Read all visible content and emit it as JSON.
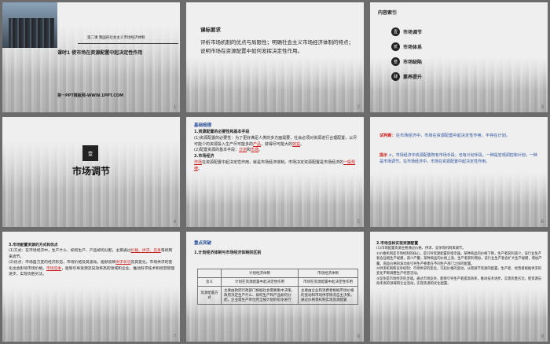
{
  "slides": [
    {
      "number": "1",
      "lesson_subtitle": "第二课  我国的社会主义市场经济体制",
      "lesson_title": "课时1    使市场在资源配置中起决定性作用",
      "watermark": "第一PPT模板网-WWW.1PPT.COM"
    },
    {
      "number": "2",
      "heading": "课标要求",
      "body": "评析市场机制的优点与局限性；明确社会主义市场经济体制的特点；说明市场在资源配置中如何发挥决定性作用。"
    },
    {
      "number": "3",
      "heading": "内容索引",
      "items": [
        {
          "badge": "壹",
          "label": "市场调节"
        },
        {
          "badge": "贰",
          "label": "市场体系"
        },
        {
          "badge": "叁",
          "label": "市场缺陷"
        },
        {
          "badge": "肆",
          "label": "素养提升"
        }
      ]
    },
    {
      "number": "4",
      "badge": "壹",
      "title": "市场调节"
    },
    {
      "number": "5",
      "tag": "基础梳理",
      "h1": "1.资源配置的必要性和基本手段",
      "p1a": "(1)资源配置的必要性：为了更好满足人类的多方面需要，社会必须对资源进行合理配置，以尽可能少的资源投入生产尽可能多的",
      "p1_blank1": "产品",
      "p1b": "，获得尽可能大的",
      "p1_blank2": "效益",
      "p1c": "。",
      "p2a": "(2)配置资源的基本手段：",
      "p2_blank1": "计划",
      "p2b": "和",
      "p2_blank2": "市场",
      "p2c": "。",
      "h2": "2.市场经济",
      "p3_blank1": "市场",
      "p3a": "在资源配置中起决定性作用，就是市场经济体制。市场决定资源配置是市场经济的",
      "p3_blank2": "一般规律",
      "p3b": "。"
    },
    {
      "number": "6",
      "l1_tag": "试判断：",
      "l1": "在市场经济中，市场在资源配置中起决定性作用，不存在计划。",
      "l2_tag": "提示",
      "l2": "×。市场经济中资源配置既有市场手段，也有计划手段。一种是宏观调控和计划；一种是市场调节。在市场经济中，市场在资源配置中起决定性作用。"
    },
    {
      "number": "7",
      "h1": "3.市场配置资源的方式和优点",
      "p1a": "(1)方式：在市场经济中，生产什么、如何生产、产品如何分配，主要通过",
      "p1_blank1": "价格、供求、竞争",
      "p1b": "等机制来调节。",
      "p2a": "(2)优点：市场是万变的经济形态，市场价格及其波动，能够反映",
      "p2_blank1": "供求状况",
      "p2b": "及其变化，市场供求的变化也会影响市场价格。",
      "p2_blank2": "市场竞争",
      "p2c": "，能够引导资源流向效率高的领域和企业，推动科学技术和经营管理进步，实现优胜劣汰。"
    },
    {
      "number": "8",
      "tag": "重点突破",
      "heading": "1.计划经济体制与市场经济体制的区别",
      "table": {
        "headers": [
          "",
          "计划经济体制",
          "市场经济体制"
        ],
        "rows": [
          [
            "含义",
            "计划在资源配置中起决定性作用",
            "市场在资源配置中起决定性作用"
          ],
          [
            "资源配置方式",
            "主要由政府行政部门根据社会需要集中决策，政府决定生产什么、如何生产和产品如何分配，企业或生产单位完全按计划的指令进行",
            "主要由企业和消费者根据市场价格的变动和市场供求情况自主决策，通过价格等机制实现资源配置"
          ]
        ]
      }
    },
    {
      "number": "9",
      "h1": "2.市场怎样实现资源配置",
      "p1": "(1)市场配置资源主要通过价格、供求、竞争等机制来调节。",
      "p2": "①价格机制是市场机制的核心，是引导资源配置的指示器。某种商品的价格下降，生产者获利减少，该行业生产者会压缩生产规模，减少产量；某种商品的价格上涨，生产者获利增加，该行业生产者会扩大生产规模，增加产量。商品价格的波动会引导生产要素在不同生产部门之间的配置。",
      "p3": "②供求机制和竞争机制：市场供求的变化，引起价格的变动，从而调节资源的配置。生产者、经营者根据供求的变化不断调整生产经营活动。",
      "p4": "③竞争是市场经济的灵魂。通过市场竞争，能够引导生产者提高效率，推动技术进步，实现优胜劣汰，使资源向效率高的领域和企业流动，实现资源的优化配置。"
    }
  ]
}
